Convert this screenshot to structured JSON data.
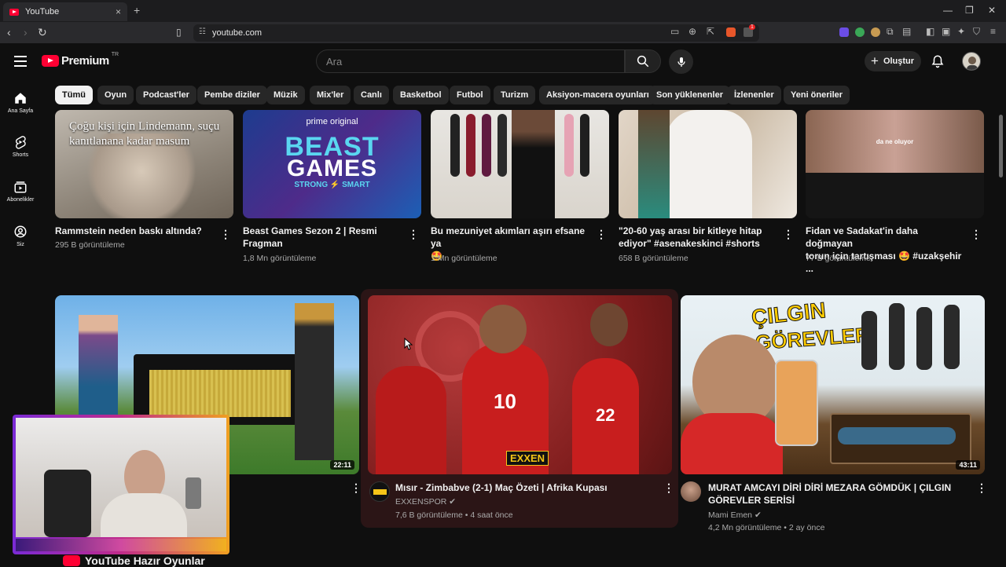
{
  "browser": {
    "tab_title": "YouTube",
    "tab_close": "×",
    "new_tab": "+",
    "url": "youtube.com",
    "extension_badge": "1"
  },
  "header": {
    "logo_word": "Premium",
    "country_code": "TR",
    "search_placeholder": "Ara",
    "create_label": "Oluştur"
  },
  "rail": [
    {
      "label": "Ana Sayfa",
      "icon": "home-icon"
    },
    {
      "label": "Shorts",
      "icon": "shorts-icon"
    },
    {
      "label": "Abonelikler",
      "icon": "subscriptions-icon"
    },
    {
      "label": "Siz",
      "icon": "you-icon"
    }
  ],
  "chips": [
    "Tümü",
    "Oyun",
    "Podcast'ler",
    "Pembe diziler",
    "Müzik",
    "Mix'ler",
    "Canlı",
    "Basketbol",
    "Futbol",
    "Turizm",
    "Aksiyon-macera oyunları",
    "Son yüklenenler",
    "İzlenenler",
    "Yeni öneriler"
  ],
  "row1": [
    {
      "title_l1": "Rammstein neden baskı altında?",
      "title_l2": "",
      "meta": "295 B görüntüleme",
      "overlay": "Çoğu kişi için Lindemann, suçu kanıtlanana kadar masum"
    },
    {
      "title_l1": "Beast Games Sezon 2 | Resmi",
      "title_l2": "Fragman",
      "meta": "1,8 Mn görüntüleme",
      "overlay_top": "prime original",
      "overlay_a": "BEAST",
      "overlay_b": "GAMES",
      "overlay_c": "STRONG ⚡ SMART"
    },
    {
      "title_l1": "Bu mezuniyet akımları aşırı efsane ya",
      "title_l2": "🤩",
      "meta": "1 Mn görüntüleme"
    },
    {
      "title_l1": "\"20-60 yaş arası bir kitleye hitap",
      "title_l2": "ediyor\" #asenakeskinci #shorts",
      "meta": "658 B görüntüleme"
    },
    {
      "title_l1": "Fidan ve Sadakat'in daha doğmayan",
      "title_l2": "torun için tartışması 🤩 #uzakşehir ...",
      "meta": "77 B görüntüleme",
      "overlay": "da ne oluyor"
    }
  ],
  "row2": [
    {
      "duration": "22:11"
    },
    {
      "title": "Mısır - Zimbabve (2-1) Maç Özeti | Afrika Kupası",
      "channel": "EXXENSPOR",
      "meta": "7,6 B görüntüleme • 4 saat önce",
      "brand": "EXXEN",
      "jersey_a": "10",
      "jersey_b": "22"
    },
    {
      "title_l1": "MURAT AMCAYI DİRİ DİRİ MEZARA GÖMDÜK | ÇILGIN",
      "title_l2": "GÖREVLER SERİSİ",
      "channel": "Mami Emen",
      "meta": "4,2 Mn görüntüleme • 2 ay önce",
      "duration": "43:11",
      "overlay_a": "ÇILGIN",
      "overlay_b": "GÖREVLER"
    }
  ],
  "bottom_shelf": "YouTube Hazır Oyunlar",
  "colors": {
    "accent": "#ff0033",
    "bg": "#0f0f0f",
    "chip": "#272727"
  }
}
